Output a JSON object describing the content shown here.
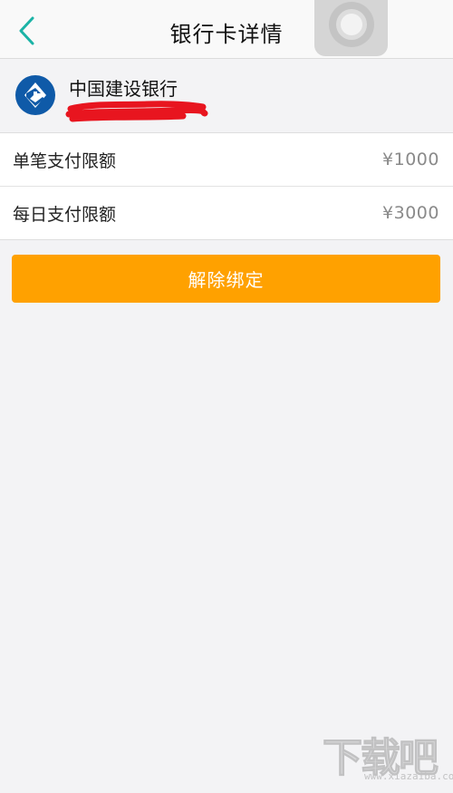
{
  "nav": {
    "title": "银行卡详情",
    "back_icon": "chevron-left-icon",
    "accent_color": "#1bb3a6"
  },
  "bank": {
    "name": "中国建设银行",
    "logo_icon": "ccb-bank-logo",
    "logo_color": "#0f5aa8",
    "card_number_redacted": true
  },
  "limits": [
    {
      "label": "单笔支付限额",
      "value": "¥1000"
    },
    {
      "label": "每日支付限额",
      "value": "¥3000"
    }
  ],
  "unbind_button": {
    "label": "解除绑定",
    "color": "#ffa100"
  },
  "watermark": {
    "big_text": "下载吧",
    "small_text": "www.xiazaiba.com"
  }
}
